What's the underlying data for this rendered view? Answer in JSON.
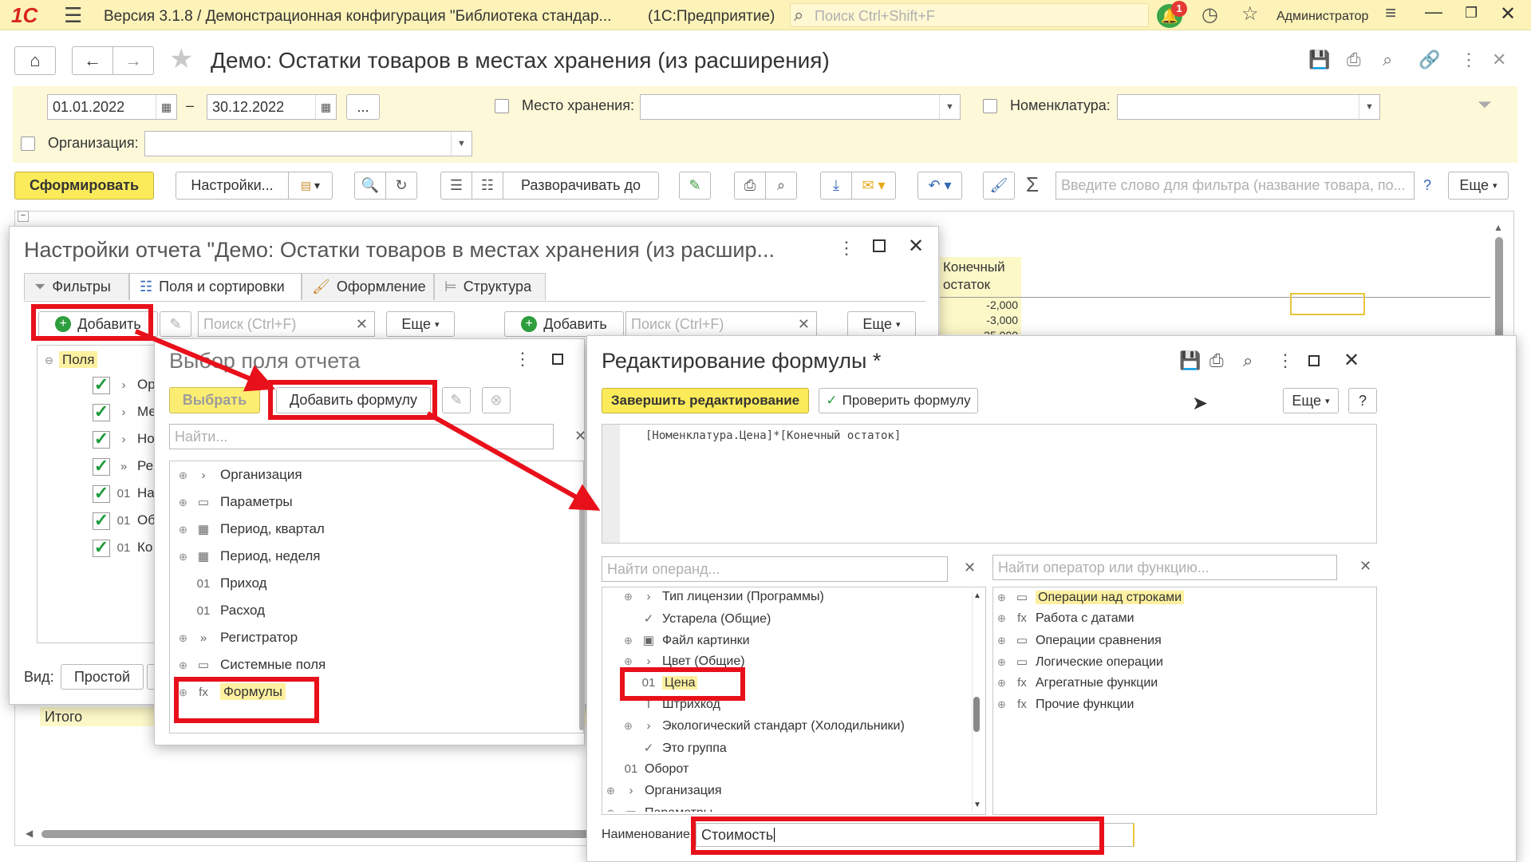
{
  "titlebar": {
    "title": "Версия 3.1.8 / Демонстрационная конфигурация \"Библиотека стандар...",
    "app_mode": "(1С:Предприятие)",
    "search_placeholder": "Поиск Ctrl+Shift+F",
    "notif_count": "1",
    "user": "Администратор"
  },
  "form": {
    "title": "Демо: Остатки товаров в местах хранения (из расширения)",
    "date_from": "01.01.2022",
    "date_to": "30.12.2022",
    "period_btn": "...",
    "dash": "–",
    "storage_label": "Место хранения:",
    "nomen_label": "Номенклатура:",
    "org_label": "Организация:",
    "generate_btn": "Сформировать",
    "settings_btn": "Настройки...",
    "expand_btn": "Разворачивать до",
    "filter_placeholder": "Введите слово для фильтра (название товара, по...",
    "help_q": "?",
    "more_btn": "Еще"
  },
  "report": {
    "col_header": [
      "Конечный",
      "остаток"
    ],
    "values": [
      "-2,000",
      "-3,000",
      "-25,000"
    ],
    "total_label": "Итого"
  },
  "settings_win": {
    "title": "Настройки отчета \"Демо: Остатки товаров в местах хранения (из расшир...",
    "tabs": [
      "Фильтры",
      "Поля и сортировки",
      "Оформление",
      "Структура"
    ],
    "add_btn": "Добавить",
    "search_placeholder": "Поиск (Ctrl+F)",
    "more_btn": "Еще",
    "add_btn2": "Добавить",
    "search_placeholder2": "Поиск (Ctrl+F)",
    "more_btn2": "Еще",
    "fields_root": "Поля",
    "fields": [
      {
        "pre": "›",
        "text": "Ор"
      },
      {
        "pre": "›",
        "text": "Ме"
      },
      {
        "pre": "›",
        "text": "Но"
      },
      {
        "pre": "»",
        "text": "Рег"
      },
      {
        "pre": "01",
        "text": "На"
      },
      {
        "pre": "01",
        "text": "Об"
      },
      {
        "pre": "01",
        "text": "Ко"
      }
    ],
    "view_label": "Вид:",
    "view_simple": "Простой",
    "view_other": "Р"
  },
  "field_select_win": {
    "title": "Выбор поля отчета",
    "select_btn": "Выбрать",
    "add_formula_btn": "Добавить формулу",
    "find_placeholder": "Найти...",
    "items": [
      {
        "exp": "⊕",
        "icon": "›",
        "label": "Организация"
      },
      {
        "exp": "⊕",
        "icon": "▭",
        "label": "Параметры"
      },
      {
        "exp": "⊕",
        "icon": "▦",
        "label": "Период, квартал"
      },
      {
        "exp": "⊕",
        "icon": "▦",
        "label": "Период, неделя"
      },
      {
        "exp": "",
        "icon": "01",
        "label": "Приход"
      },
      {
        "exp": "",
        "icon": "01",
        "label": "Расход"
      },
      {
        "exp": "⊕",
        "icon": "»",
        "label": "Регистратор"
      },
      {
        "exp": "⊕",
        "icon": "▭",
        "label": "Системные поля"
      },
      {
        "exp": "⊕",
        "icon": "fx",
        "label": "Формулы"
      }
    ]
  },
  "formula_win": {
    "title": "Редактирование формулы *",
    "finish_btn": "Завершить редактирование",
    "check_btn": "Проверить формулу",
    "more_btn": "Еще",
    "help_btn": "?",
    "formula_text": "[Номенклатура.Цена]*[Конечный остаток]",
    "operand_placeholder": "Найти операнд...",
    "operator_placeholder": "Найти оператор или функцию...",
    "operands": [
      {
        "indent": 1,
        "exp": "⊕",
        "icon": "›",
        "label": "Тип лицензии (Программы)"
      },
      {
        "indent": 1,
        "exp": "",
        "icon": "✓",
        "label": "Устарела (Общие)"
      },
      {
        "indent": 1,
        "exp": "⊕",
        "icon": "▣",
        "label": "Файл картинки"
      },
      {
        "indent": 1,
        "exp": "⊕",
        "icon": "›",
        "label": "Цвет (Общие)"
      },
      {
        "indent": 1,
        "exp": "",
        "icon": "01",
        "label": "Цена"
      },
      {
        "indent": 1,
        "exp": "",
        "icon": "T",
        "label": "Штрихкод"
      },
      {
        "indent": 1,
        "exp": "⊕",
        "icon": "›",
        "label": "Экологический стандарт (Холодильники)"
      },
      {
        "indent": 1,
        "exp": "",
        "icon": "✓",
        "label": "Это группа"
      },
      {
        "indent": 0,
        "exp": "",
        "icon": "01",
        "label": "Оборот"
      },
      {
        "indent": 0,
        "exp": "⊕",
        "icon": "›",
        "label": "Организация"
      },
      {
        "indent": 0,
        "exp": "⊕",
        "icon": "▭",
        "label": "Параметры"
      }
    ],
    "operators": [
      {
        "icon": "▭",
        "label": "Операции над строками"
      },
      {
        "icon": "fx",
        "label": "Работа с датами"
      },
      {
        "icon": "▭",
        "label": "Операции сравнения"
      },
      {
        "icon": "▭",
        "label": "Логические операции"
      },
      {
        "icon": "fx",
        "label": "Агрегатные функции"
      },
      {
        "icon": "fx",
        "label": "Прочие функции"
      }
    ],
    "name_label": "Наименование:",
    "name_value": "Стоимость"
  },
  "colors": {
    "accent_yellow": "#fbeb5a",
    "highlight_red": "#e8101a",
    "filter_bg": "#fdf8d8",
    "green": "#1e9a3a"
  }
}
